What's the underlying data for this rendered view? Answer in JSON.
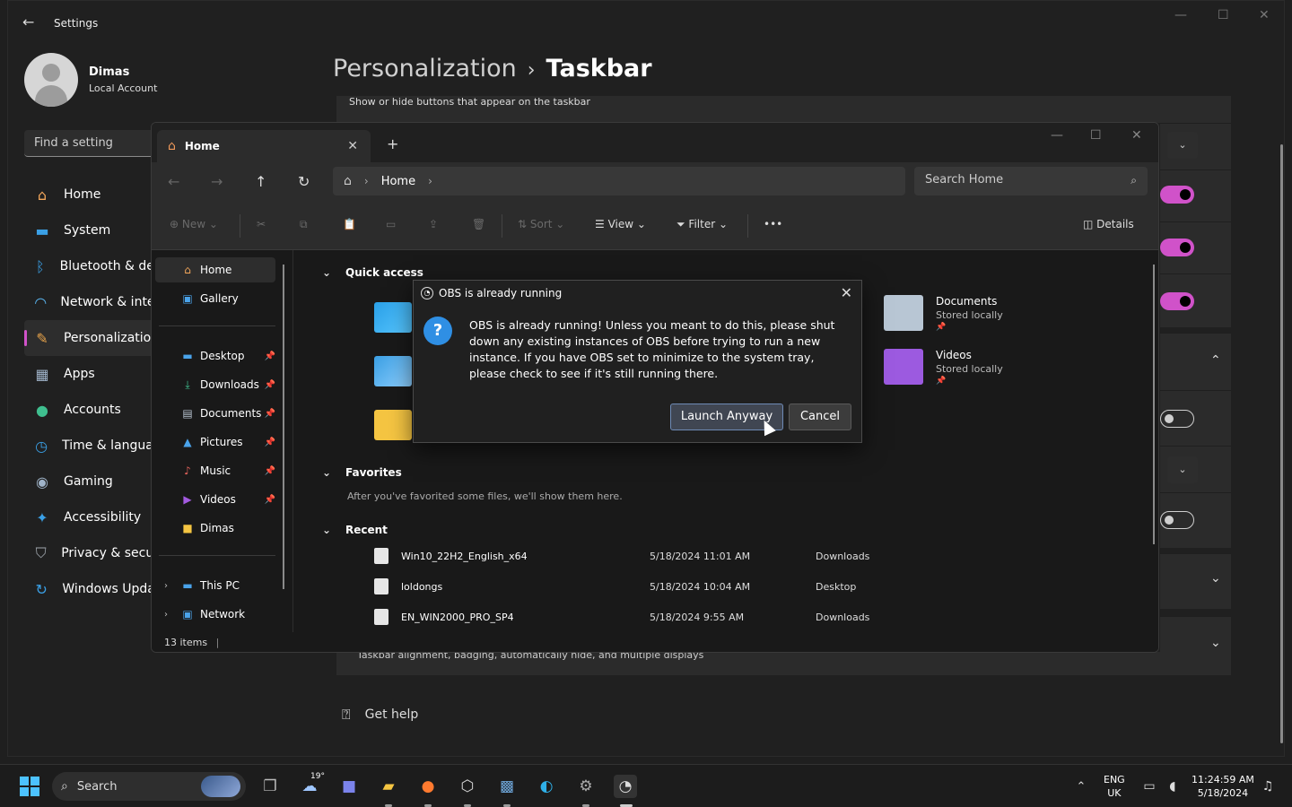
{
  "settings": {
    "title": "Settings",
    "user": {
      "name": "Dimas",
      "account": "Local Account"
    },
    "find_placeholder": "Find a setting",
    "nav": [
      {
        "label": "Home",
        "icon": "home-icon"
      },
      {
        "label": "System",
        "icon": "monitor-icon"
      },
      {
        "label": "Bluetooth & devices",
        "icon": "bluetooth-icon"
      },
      {
        "label": "Network & internet",
        "icon": "wifi-icon"
      },
      {
        "label": "Personalization",
        "icon": "brush-icon"
      },
      {
        "label": "Apps",
        "icon": "apps-icon"
      },
      {
        "label": "Accounts",
        "icon": "person-icon"
      },
      {
        "label": "Time & language",
        "icon": "globe-clock-icon"
      },
      {
        "label": "Gaming",
        "icon": "gamepad-icon"
      },
      {
        "label": "Accessibility",
        "icon": "accessibility-icon"
      },
      {
        "label": "Privacy & security",
        "icon": "shield-icon"
      },
      {
        "label": "Windows Update",
        "icon": "update-icon"
      }
    ],
    "active_nav": "Personalization",
    "breadcrumb": {
      "parent": "Personalization",
      "current": "Taskbar"
    },
    "section_desc": "Show or hide buttons that appear on the taskbar",
    "lower_desc": "Taskbar alignment, badging, automatically hide, and multiple displays",
    "get_help": "Get help",
    "accent_color": "#d052c9"
  },
  "explorer": {
    "tab_label": "Home",
    "address": {
      "segment": "Home"
    },
    "search_placeholder": "Search Home",
    "toolbar": {
      "new": "New",
      "sort": "Sort",
      "view": "View",
      "filter": "Filter",
      "more": "•••",
      "details": "Details"
    },
    "sidebar": {
      "top": [
        {
          "label": "Home",
          "icon": "home-icon"
        },
        {
          "label": "Gallery",
          "icon": "gallery-icon"
        }
      ],
      "pinned": [
        {
          "label": "Desktop",
          "icon": "desktop-icon"
        },
        {
          "label": "Downloads",
          "icon": "download-icon"
        },
        {
          "label": "Documents",
          "icon": "document-icon"
        },
        {
          "label": "Pictures",
          "icon": "pictures-icon"
        },
        {
          "label": "Music",
          "icon": "music-icon"
        },
        {
          "label": "Videos",
          "icon": "video-icon"
        },
        {
          "label": "Dimas",
          "icon": "folder-icon"
        }
      ],
      "bottom": [
        {
          "label": "This PC",
          "icon": "pc-icon"
        },
        {
          "label": "Network",
          "icon": "network-icon"
        }
      ]
    },
    "sections": {
      "quick_access": "Quick access",
      "favorites": "Favorites",
      "recent": "Recent"
    },
    "quick_access_tiles": [
      {
        "name": "Documents",
        "status": "Stored locally"
      },
      {
        "name": "Videos",
        "status": "Stored locally"
      }
    ],
    "favorites_note": "After you've favorited some files, we'll show them here.",
    "recent": [
      {
        "name": "Win10_22H2_English_x64",
        "date": "5/18/2024 11:01 AM",
        "location": "Downloads"
      },
      {
        "name": "loldongs",
        "date": "5/18/2024 10:04 AM",
        "location": "Desktop"
      },
      {
        "name": "EN_WIN2000_PRO_SP4",
        "date": "5/18/2024 9:55 AM",
        "location": "Downloads"
      }
    ],
    "status": "13 items"
  },
  "dialog": {
    "title": "OBS is already running",
    "message": "OBS is already running! Unless you meant to do this, please shut down any existing instances of OBS before trying to run a new instance. If you have OBS set to minimize to the system tray, please check to see if it's still running there.",
    "launch_label": "Launch Anyway",
    "cancel_label": "Cancel"
  },
  "taskbar": {
    "search_label": "Search",
    "weather_temp": "19°",
    "language": {
      "line1": "ENG",
      "line2": "UK"
    },
    "time": "11:24:59 AM",
    "date": "5/18/2024"
  }
}
